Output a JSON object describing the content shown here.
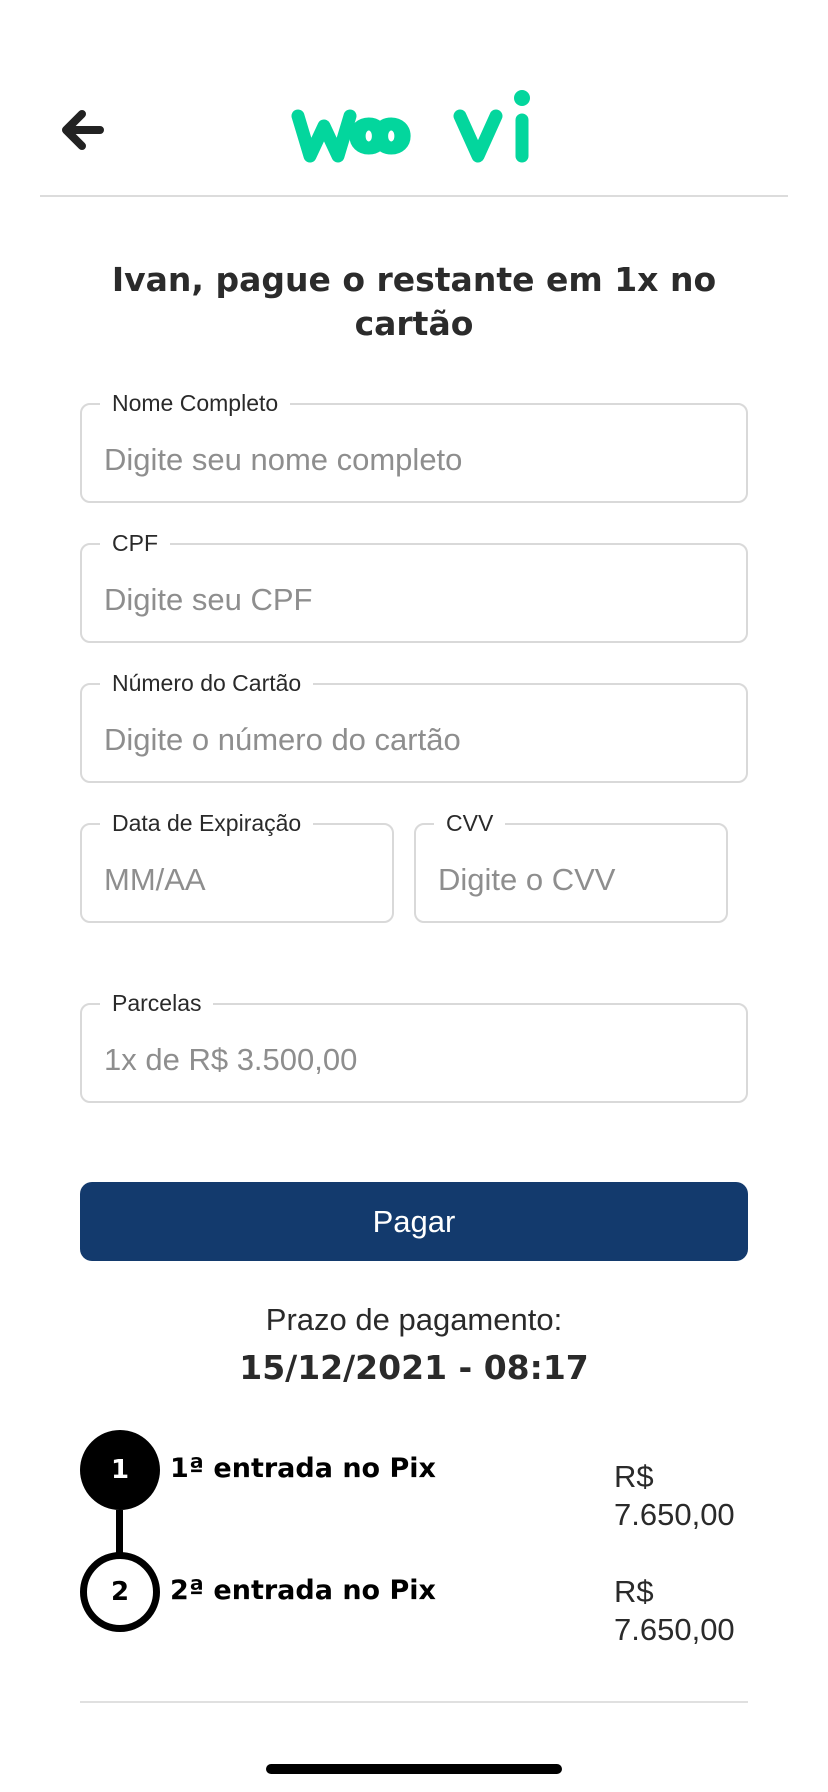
{
  "header": {
    "back_icon": "arrow-left-icon",
    "logo_text": "woovi",
    "logo_color": "#03d69d"
  },
  "title": "Ivan, pague o restante em 1x no cartão",
  "form": {
    "name": {
      "label": "Nome Completo",
      "placeholder": "Digite seu nome completo"
    },
    "cpf": {
      "label": "CPF",
      "placeholder": "Digite seu CPF"
    },
    "card_number": {
      "label": "Número do Cartão",
      "placeholder": "Digite o número do cartão"
    },
    "expiry": {
      "label": "Data de Expiração",
      "placeholder": "MM/AA"
    },
    "cvv": {
      "label": "CVV",
      "placeholder": "Digite o CVV"
    },
    "installments": {
      "label": "Parcelas",
      "value": "1x de R$ 3.500,00"
    }
  },
  "pay_button": {
    "label": "Pagar",
    "color": "#133a6d"
  },
  "deadline": {
    "label": "Prazo de pagamento:",
    "value": "15/12/2021 - 08:17"
  },
  "steps": [
    {
      "number": "1",
      "title": "1ª entrada no Pix",
      "currency": "R$",
      "amount": "7.650,00"
    },
    {
      "number": "2",
      "title": "2ª entrada no Pix",
      "currency": "R$",
      "amount": "7.650,00"
    }
  ]
}
